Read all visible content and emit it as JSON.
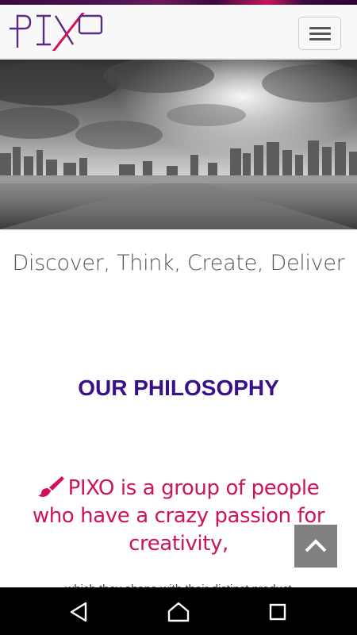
{
  "header": {
    "logo_text": "PIXO",
    "menu_toggle_label": "Toggle navigation"
  },
  "hero": {
    "tagline": "Discover, Think, Create, Deliver"
  },
  "philosophy": {
    "title": "OUR PHILOSOPHY",
    "statement": "PIXO is a group of people who have a crazy passion for creativity,",
    "icon": "paint-brush-icon",
    "next_line_partial": "which they shape with their distinct product"
  },
  "floating": {
    "back_to_top_icon": "chevron-up-icon"
  },
  "system_nav": {
    "back_icon": "back-triangle-icon",
    "home_icon": "home-circle-icon",
    "recents_icon": "recents-square-icon"
  },
  "colors": {
    "accent_pink": "#d0115d",
    "title_purple": "#3a0f8a",
    "logo_purple": "#5a2a82"
  }
}
